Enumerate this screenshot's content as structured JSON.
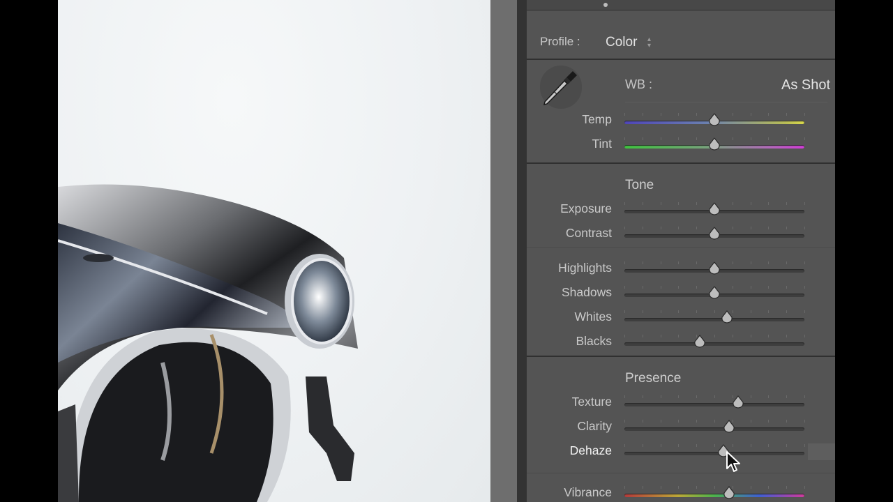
{
  "panel": {
    "profile_label": "Profile :",
    "profile_value": "Color",
    "wb_label": "WB :",
    "wb_value": "As Shot",
    "sections": {
      "tone": "Tone",
      "presence": "Presence"
    },
    "sliders": [
      {
        "id": "temp",
        "label": "Temp",
        "value": 0.5,
        "track": "temp"
      },
      {
        "id": "tint",
        "label": "Tint",
        "value": 0.5,
        "track": "tint"
      },
      {
        "id": "exposure",
        "label": "Exposure",
        "value": 0.5,
        "track": "plain"
      },
      {
        "id": "contrast",
        "label": "Contrast",
        "value": 0.5,
        "track": "plain"
      },
      {
        "id": "highlights",
        "label": "Highlights",
        "value": 0.5,
        "track": "plain"
      },
      {
        "id": "shadows",
        "label": "Shadows",
        "value": 0.5,
        "track": "plain"
      },
      {
        "id": "whites",
        "label": "Whites",
        "value": 0.57,
        "track": "plain"
      },
      {
        "id": "blacks",
        "label": "Blacks",
        "value": 0.42,
        "track": "plain"
      },
      {
        "id": "texture",
        "label": "Texture",
        "value": 0.63,
        "track": "plain"
      },
      {
        "id": "clarity",
        "label": "Clarity",
        "value": 0.58,
        "track": "plain"
      },
      {
        "id": "dehaze",
        "label": "Dehaze",
        "value": 0.55,
        "track": "plain"
      },
      {
        "id": "vibrance",
        "label": "Vibrance",
        "value": 0.58,
        "track": "vib"
      }
    ]
  },
  "icons": {
    "eyedropper": "eyedropper-icon",
    "profile_arrows": "updown-arrows-icon",
    "cursor": "mouse-pointer-icon"
  },
  "colors": {
    "panel_bg": "#545454",
    "photo_bg": "#eef1f3"
  }
}
